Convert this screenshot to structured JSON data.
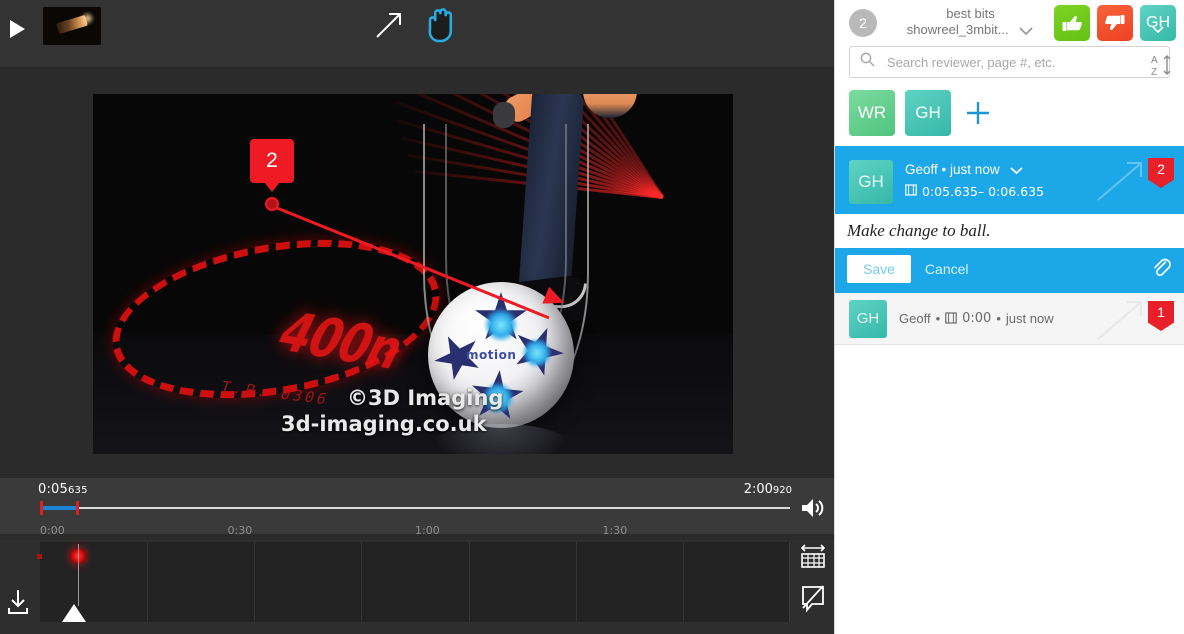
{
  "toolbar": {
    "thumbnail_name": "video-thumbnail",
    "arrow_tool_label": "Arrow",
    "hand_tool_label": "Hand"
  },
  "video": {
    "watermark_line1": "©3D Imaging",
    "watermark_line2": "3d-imaging.co.uk",
    "laser_word": "400n",
    "laser_sub": "T.P.  0306",
    "ball_brand": "motion",
    "annotation_marker": "2"
  },
  "player": {
    "current_time": "0:05",
    "current_time_ms": "635",
    "total_time": "2:00",
    "total_time_ms": "920",
    "play_label": "Play",
    "volume_label": "Volume",
    "ticks": [
      {
        "label": "0:00",
        "pos": 0
      },
      {
        "label": "0:30",
        "pos": 25
      },
      {
        "label": "1:00",
        "pos": 50
      },
      {
        "label": "1:30",
        "pos": 75
      }
    ],
    "download_label": "Download",
    "filmstrip_label": "Timeline zoom",
    "hide_comments_label": "Hide comments"
  },
  "sidebar": {
    "comment_count": "2",
    "title_line1": "best bits",
    "title_line2": "showreel_3mbit...",
    "approve_label": "Approve",
    "reject_label": "Request changes",
    "user_initials": "GH",
    "search": {
      "placeholder": "Search reviewer, page #, etc.",
      "value": ""
    },
    "sort_label": "Sort A-Z",
    "reviewers": [
      {
        "initials": "WR"
      },
      {
        "initials": "GH"
      }
    ],
    "add_reviewer_label": "Add reviewer"
  },
  "comments": [
    {
      "avatar": "GH",
      "author": "Geoff",
      "separator": "•",
      "timestamp": "just now",
      "time_range": "0:05.635– 0:06.635",
      "draft_text": "Make change to ball.",
      "save_label": "Save",
      "cancel_label": "Cancel",
      "attach_label": "Attach file",
      "badge": "2"
    },
    {
      "avatar": "GH",
      "author": "Geoff",
      "separator": "•",
      "time": "0:00",
      "timestamp": "just now",
      "badge": "1"
    }
  ],
  "colors": {
    "accent_blue": "#1ba7e8",
    "marker_red": "#e8202a",
    "approve_green": "#6fc91a",
    "reject_red": "#ef4123",
    "avatar_teal": "#45c4b4",
    "avatar_green": "#5fcf8c"
  }
}
